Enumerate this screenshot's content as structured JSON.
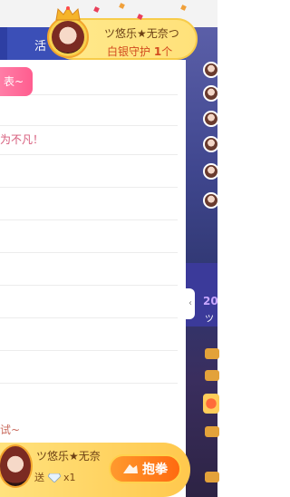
{
  "tabs": {
    "active_label": "活"
  },
  "chat": {
    "pill_label": "表~",
    "messages": [
      "为不凡！",
      "试~"
    ]
  },
  "guardian_banner": {
    "name": "ツ悠乐★无奈つ",
    "rank_prefix": "白银守护 ",
    "rank_count": "1",
    "rank_suffix": "个"
  },
  "right_rail": {
    "year_text": "20",
    "sub_text": "ツ"
  },
  "gift_banner": {
    "name": "ツ悠乐★无奈",
    "send_label": "送",
    "count": "x1",
    "button_label": "抱拳"
  },
  "colors": {
    "tab_blue": "#3b4fb7",
    "gold": "#ffe17a",
    "accent_orange": "#ff6a10",
    "pink": "#ff5d8f"
  }
}
